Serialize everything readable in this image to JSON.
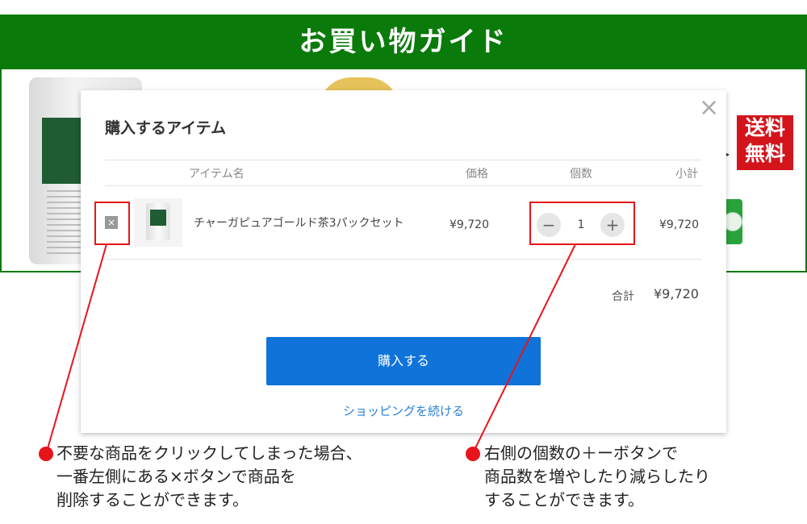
{
  "banner": {
    "title": "お買い物ガイド"
  },
  "badge": {
    "line1": "送料",
    "line2": "無料"
  },
  "modal": {
    "title": "購入するアイテム",
    "close_label": "×",
    "columns": {
      "item": "アイテム名",
      "price": "価格",
      "qty": "個数",
      "subtotal": "小計"
    },
    "item": {
      "remove_label": "×",
      "name": "チャーガピュアゴールド茶3パックセット",
      "price": "¥9,720",
      "qty_minus": "−",
      "qty": "1",
      "qty_plus": "+",
      "subtotal": "¥9,720"
    },
    "total_label": "合計",
    "total_value": "¥9,720",
    "buy_label": "購入する",
    "continue_label": "ショッピングを続ける"
  },
  "annotations": {
    "remove_note": [
      "不要な商品をクリックしてしまった場合、",
      "一番左側にある×ボタンで商品を",
      "削除することができます。"
    ],
    "qty_note": [
      "右側の個数の＋ーボタンで",
      "商品数を増やしたり減らしたり",
      "することができます。"
    ]
  },
  "colors": {
    "banner": "#0a7a0a",
    "buy_button": "#0f73d9",
    "annotation": "#e8141b",
    "badge": "#d3141b"
  }
}
